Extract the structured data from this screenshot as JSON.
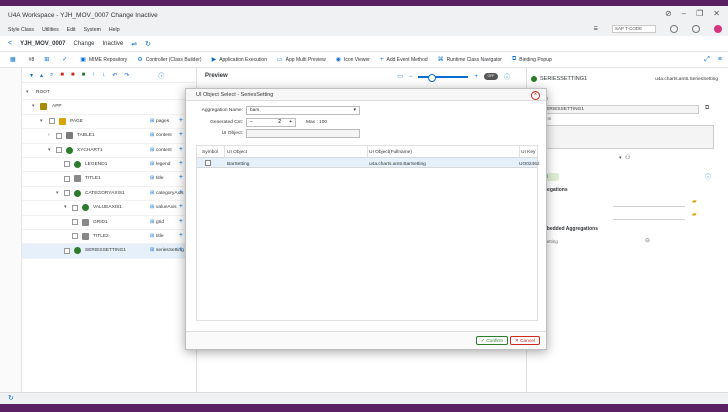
{
  "window": {
    "title": "U4A Workspace - YJH_MOV_0007 Change Inactive"
  },
  "menu": {
    "items": [
      "Style Class",
      "Utilities",
      "Edit",
      "System",
      "Help"
    ],
    "tcode_placeholder": "SAP T-CODE"
  },
  "nav": {
    "back": "<",
    "app_name": "YJH_MOV_0007",
    "mode": "Change",
    "status": "Inactive"
  },
  "toolbar": {
    "mime": "MIME Repository",
    "controller": "Controller (Class Builder)",
    "execution": "Application Execution",
    "multi_preview": "App Multi Preview",
    "icon_viewer": "Icon Viewer",
    "add_event": "Add Event Method",
    "runtime_nav": "Runtime Class Navigator",
    "binding_popup": "Binding Popup",
    "num": "#8"
  },
  "tree": {
    "rows": [
      {
        "label": "ROOT",
        "agg": ""
      },
      {
        "label": "APP",
        "agg": ""
      },
      {
        "label": "PAGE",
        "agg": "pages"
      },
      {
        "label": "TABLE1",
        "agg": "content"
      },
      {
        "label": "XYCHART1",
        "agg": "content"
      },
      {
        "label": "LEGEND1",
        "agg": "legend"
      },
      {
        "label": "TITLE1",
        "agg": "title"
      },
      {
        "label": "CATEGORYAXIS1",
        "agg": "categoryAxis"
      },
      {
        "label": "VALUEAXIS1",
        "agg": "valueAxis"
      },
      {
        "label": "GRID1",
        "agg": "grid"
      },
      {
        "label": "TITLE2",
        "agg": "title"
      },
      {
        "label": "SERIESSETTING1",
        "agg": "seriesSetting"
      }
    ]
  },
  "preview": {
    "title": "Preview",
    "toggle": "OFF"
  },
  "properties": {
    "object_id": "SERIESSETTING1",
    "class": "u4a.charts.am5.SeriesSetting",
    "label_id": "ct ID",
    "label_desc": "ription",
    "input_id": "SERIESSETTING1",
    "badge": "uel",
    "section1": "ggregations",
    "row1": "es",
    "row2": "nts",
    "section2": "Embedded Aggregations",
    "row3": "esSetting"
  },
  "dialog": {
    "title": "UI Object Select - SeriesSetting",
    "agg_label": "Aggregation Name:",
    "agg_value": "bars",
    "gen_label": "Generated Cnt:",
    "gen_value": "2",
    "max_text": "Max : 100",
    "obj_label": "UI Object:",
    "columns": [
      "Symbol",
      "UI Object",
      "UI Object(Fullname)",
      "UI Key"
    ],
    "row": {
      "ui_object": "BarSetting",
      "fullname": "u4a.charts.am5.BarSetting",
      "ui_key": "UO02462"
    },
    "confirm": "Confirm",
    "cancel": "Cancel"
  }
}
